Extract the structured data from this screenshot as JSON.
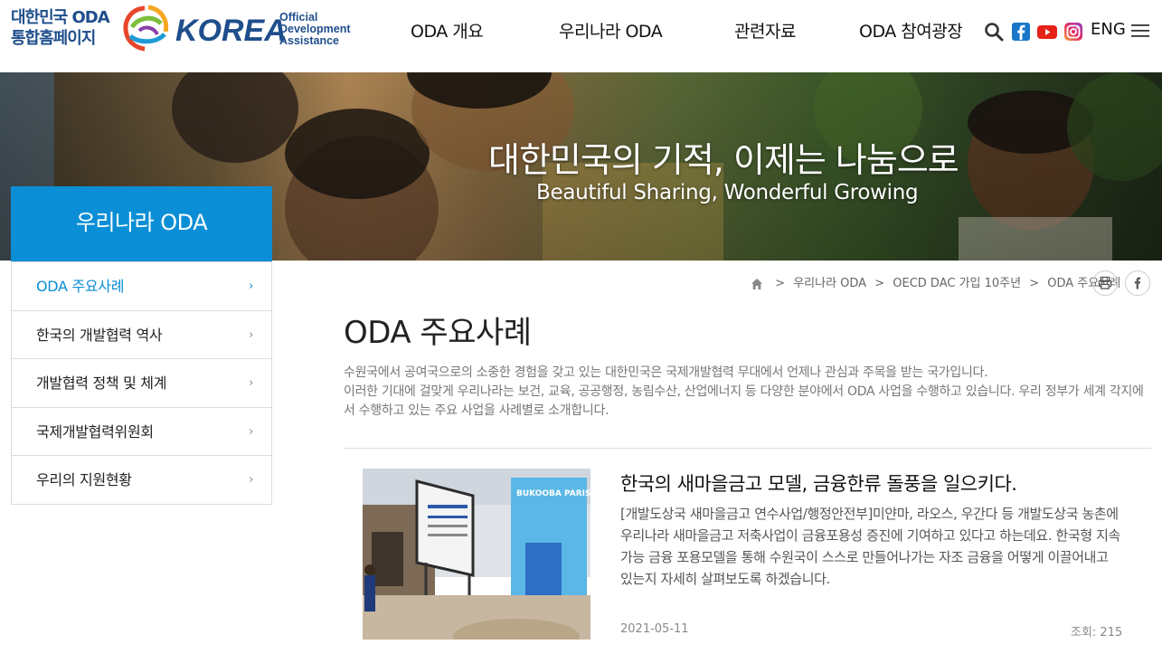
{
  "header": {
    "site_title": "대한민국 ODA 통합홈페이지",
    "logo_wordmark": "KOREA",
    "logo_tagline_1": "Official",
    "logo_tagline_2": "Development",
    "logo_tagline_3": "Assistance",
    "nav": [
      "ODA 개요",
      "우리나라 ODA",
      "관련자료",
      "ODA 참여광장"
    ],
    "eng_label": "ENG",
    "icons": [
      "search-icon",
      "facebook-icon",
      "youtube-icon",
      "instagram-icon",
      "hamburger-menu-icon"
    ]
  },
  "banner": {
    "title": "대한민국의 기적, 이제는 나눔으로",
    "subtitle": "Beautiful Sharing, Wonderful Growing"
  },
  "sidebar": {
    "heading": "우리나라 ODA",
    "items": [
      {
        "label": "ODA 주요사례",
        "active": true
      },
      {
        "label": "한국의 개발협력 역사",
        "active": false
      },
      {
        "label": "개발협력 정책 및 체계",
        "active": false
      },
      {
        "label": "국제개발협력위원회",
        "active": false
      },
      {
        "label": "우리의 지원현황",
        "active": false
      }
    ]
  },
  "breadcrumb": {
    "items": [
      "우리나라 ODA",
      "OECD DAC 가입 10주년",
      "ODA 주요사례"
    ],
    "separator": ">"
  },
  "main": {
    "title": "ODA 주요사례",
    "intro_line1": "수원국에서 공여국으로의 소중한 경험을 갖고 있는 대한민국은 국제개발협력 무대에서 언제나 관심과 주목을 받는 국가입니다.",
    "intro_line2": "이러한 기대에 걸맞게 우리나라는 보건, 교육, 공공행정, 농림수산, 산업에너지 등 다양한 분야에서 ODA 사업을 수행하고 있습니다. 우리 정부가 세계 각지에서 수행하고 있는 주요 사업을 사례별로 소개합니다."
  },
  "case": {
    "title": "한국의 새마을금고 모델, 금융한류 돌풍을 일으키다.",
    "description": "[개발도상국 새마을금고 연수사업/행정안전부]미얀마, 라오스, 우간다 등 개발도상국 농촌에 우리나라 새마을금고 저축사업이 금융포용성 증진에 기여하고 있다고 하는데요. 한국형 지속가능 금융 포용모델을 통해 수원국이 스스로 만들어나가는 자조 금융을 어떻게 이끌어내고 있는지 자세히 살펴보도록 하겠습니다.",
    "date": "2021-05-11",
    "views": "조회: 215",
    "photo_sign": "BUKOOBA PARISH MG"
  },
  "colors": {
    "primary": "#0a8fd6",
    "logo_blue": "#1f4e8c"
  }
}
